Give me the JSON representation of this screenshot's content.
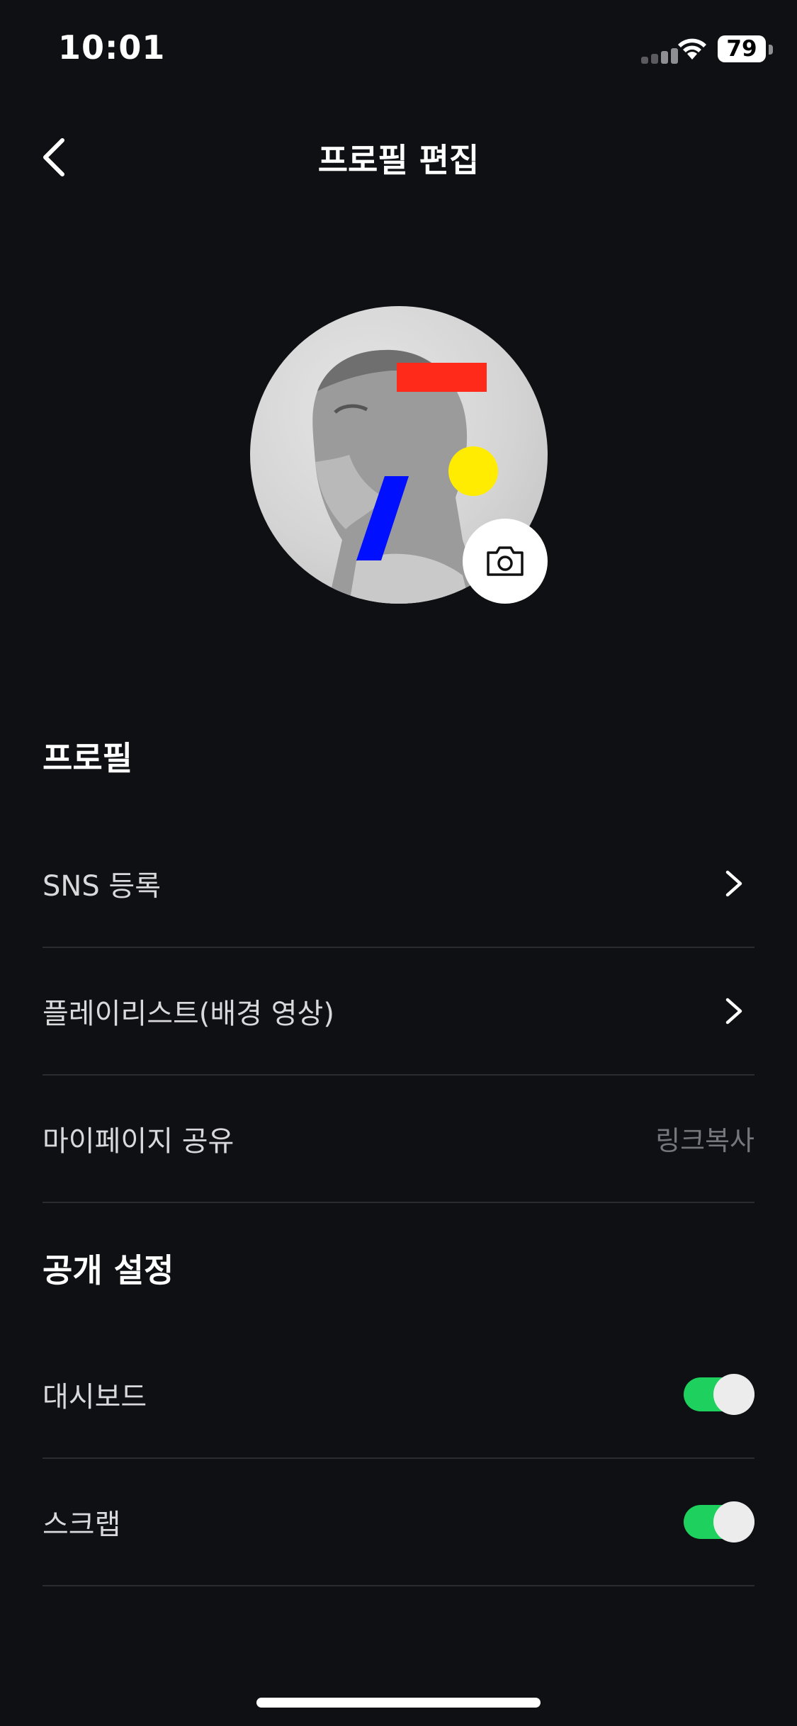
{
  "status_bar": {
    "time": "10:01",
    "battery": "79"
  },
  "header": {
    "title": "프로필 편집"
  },
  "profile_section": {
    "title": "프로필",
    "items": [
      {
        "label": "SNS 등록"
      },
      {
        "label": "플레이리스트(배경 영상)"
      },
      {
        "label": "마이페이지 공유",
        "value": "링크복사"
      }
    ]
  },
  "privacy_section": {
    "title": "공개 설정",
    "items": [
      {
        "label": "대시보드",
        "on": true
      },
      {
        "label": "스크랩",
        "on": true
      }
    ]
  },
  "colors": {
    "background": "#0f1013",
    "toggle_on": "#1ed15f",
    "divider": "#2b2c30",
    "avatar_red": "#ff2a1a",
    "avatar_yellow": "#ffec00",
    "avatar_blue": "#0010ff"
  }
}
